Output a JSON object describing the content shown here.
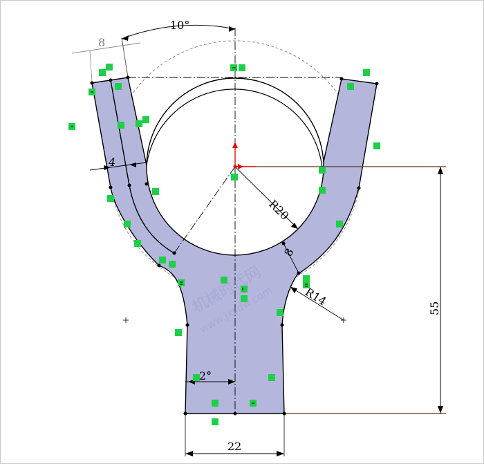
{
  "dimensions": {
    "angle_top": "10°",
    "width_top": "8",
    "thickness_left": "4",
    "radius_circle": "R20",
    "thickness_ring": "8",
    "radius_fillet": "R14",
    "height_total": "55",
    "angle_stem": "2°",
    "width_bottom": "22"
  },
  "watermark": {
    "line1": "机械时代网",
    "line2": "www.jxsdw.com"
  },
  "colors": {
    "part_fill": "#b4b6dc",
    "part_stroke": "#000000",
    "relation_green": "#1fcf4a",
    "dim_line_brown": "#5a3218",
    "origin_red": "#d11"
  }
}
